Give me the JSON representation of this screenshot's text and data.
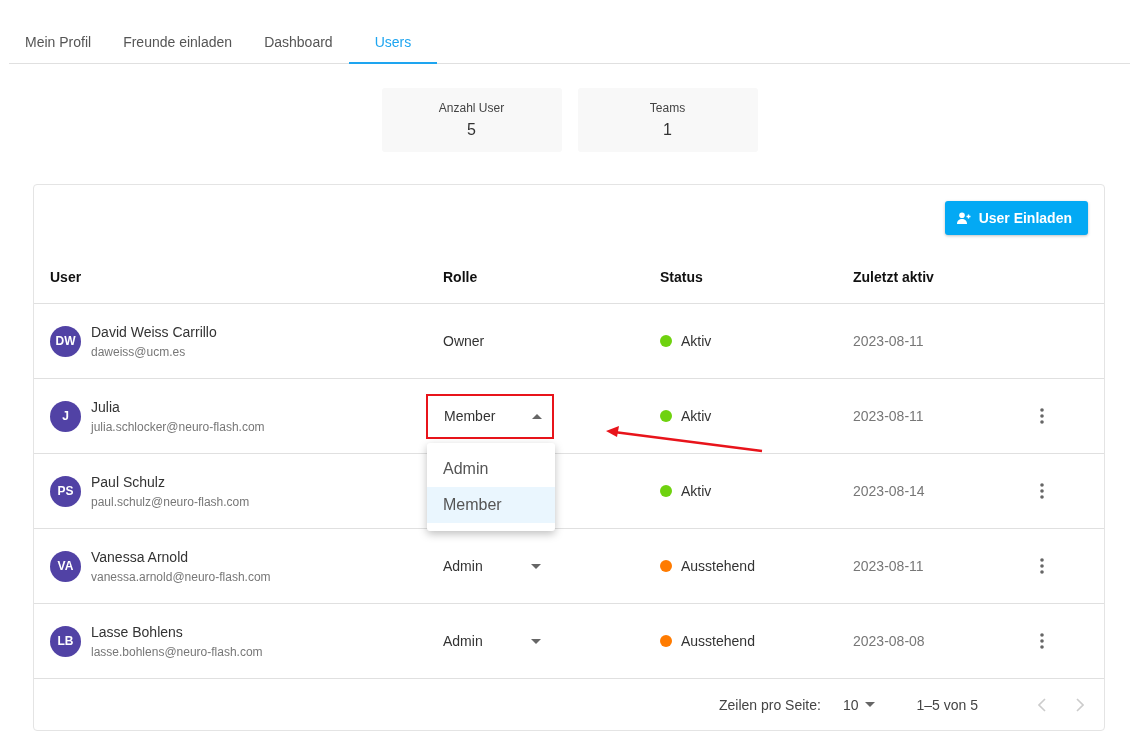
{
  "tabs": [
    {
      "label": "Mein Profil",
      "selected": false
    },
    {
      "label": "Freunde einladen",
      "selected": false
    },
    {
      "label": "Dashboard",
      "selected": false
    },
    {
      "label": "Users",
      "selected": true
    }
  ],
  "stats": [
    {
      "label": "Anzahl User",
      "value": "5"
    },
    {
      "label": "Teams",
      "value": "1"
    }
  ],
  "invite_button": {
    "label": "User Einladen"
  },
  "table": {
    "columns": [
      "User",
      "Rolle",
      "Status",
      "Zuletzt aktiv"
    ],
    "rows": [
      {
        "initials": "DW",
        "name": "David Weiss Carrillo",
        "email": "daweiss@ucm.es",
        "role": "Owner",
        "kind": "text",
        "status": "Aktiv",
        "color": "#6fd20f",
        "last_active": "2023-08-11",
        "has_menu": false
      },
      {
        "initials": "J",
        "name": "Julia",
        "email": "julia.schlocker@neuro-flash.com",
        "role": "Member",
        "kind": "open",
        "status": "Aktiv",
        "color": "#6fd20f",
        "last_active": "2023-08-11",
        "has_menu": true,
        "options": [
          {
            "label": "Admin",
            "selected": false
          },
          {
            "label": "Member",
            "selected": true
          }
        ]
      },
      {
        "initials": "PS",
        "name": "Paul Schulz",
        "email": "paul.schulz@neuro-flash.com",
        "kind": "hidden",
        "status": "Aktiv",
        "color": "#6fd20f",
        "last_active": "2023-08-14",
        "has_menu": true
      },
      {
        "initials": "VA",
        "name": "Vanessa Arnold",
        "email": "vanessa.arnold@neuro-flash.com",
        "role": "Admin",
        "kind": "select",
        "status": "Ausstehend",
        "color": "#ff7b00",
        "last_active": "2023-08-11",
        "has_menu": true
      },
      {
        "initials": "LB",
        "name": "Lasse Bohlens",
        "email": "lasse.bohlens@neuro-flash.com",
        "role": "Admin",
        "kind": "select",
        "status": "Ausstehend",
        "color": "#ff7b00",
        "last_active": "2023-08-08",
        "has_menu": true
      }
    ]
  },
  "pagination": {
    "rows_label": "Zeilen pro Seite:",
    "rows_value": "10",
    "range": "1–5 von 5"
  }
}
